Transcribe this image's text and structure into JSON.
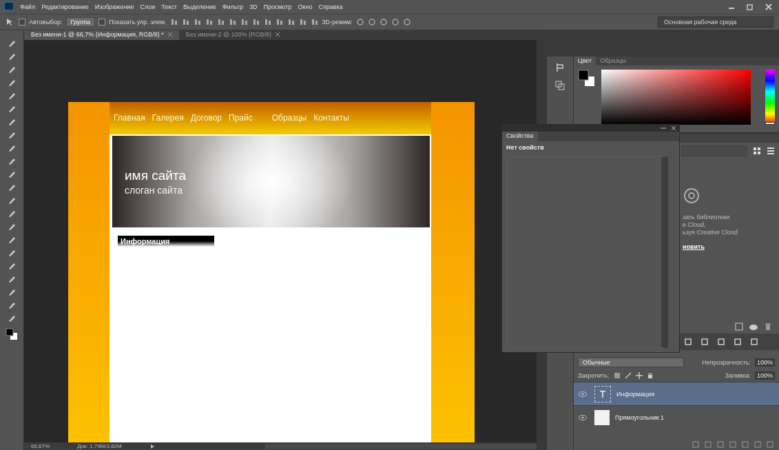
{
  "menu": [
    "Файл",
    "Редактирование",
    "Изображение",
    "Слои",
    "Текст",
    "Выделение",
    "Фильтр",
    "3D",
    "Просмотр",
    "Окно",
    "Справка"
  ],
  "options_bar": {
    "auto_select_checked": false,
    "show_transform_checked": false,
    "auto_select_label": "Автовыбор:",
    "auto_select_value": "Группа",
    "show_transform": "Показать упр. элем.",
    "mode_label": "3D-режим:",
    "workspace": "Основная рабочая среда"
  },
  "document_tabs": [
    {
      "title": "Без имени-1 @ 66,7% (Информация, RGB/8) *",
      "selected": true
    },
    {
      "title": "Без имени-2 @ 100% (RGB/8)",
      "selected": false
    }
  ],
  "canvas": {
    "nav": [
      "Главная",
      "Галерея",
      "Договор",
      "Прайс",
      "Образцы",
      "Контакты"
    ],
    "site_name": "имя сайта",
    "slogan": "слоган сайта",
    "section_heading": "Информация"
  },
  "color_panel": {
    "tabs": [
      {
        "label": "Цвет",
        "selected": true
      },
      {
        "label": "Образцы",
        "selected": false
      }
    ],
    "hue": {
      "level": 0
    }
  },
  "libraries_panel": {
    "lines": [
      "зать библиотеки",
      "e Cloud,",
      "ьзуя Creative Cloud"
    ],
    "link": "новить"
  },
  "properties_panel": {
    "title": "Свойства",
    "message": "Нет свойств"
  },
  "layers_panel": {
    "blend_mode": "Обычные",
    "opacity_label": "Непрозрачность:",
    "opacity": "100%",
    "lock_label": "Закрепить:",
    "fill_label": "Заливка:",
    "fill": "100%",
    "layers": [
      {
        "name": "Информация",
        "kind": "text",
        "thumb_text": "T",
        "selected": true,
        "visible": true
      },
      {
        "name": "Прямоугольник 1",
        "kind": "shape",
        "selected": false,
        "visible": true
      }
    ]
  },
  "status_bar": {
    "zoom": "66,67%",
    "doc_info": "Док: 1,79M/3,82M"
  }
}
